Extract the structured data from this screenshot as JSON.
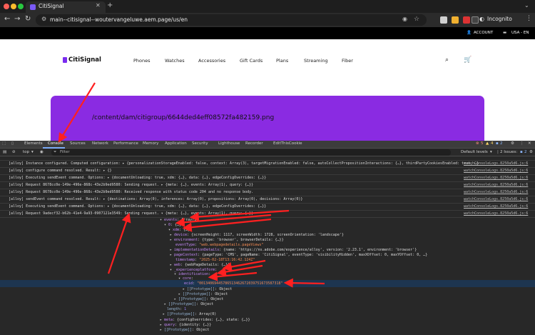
{
  "browser": {
    "tab_title": "CitiSignal",
    "url": "main--citisignal--woutervangeluwe.aem.page/us/en",
    "profile": "Incognito"
  },
  "site": {
    "util": {
      "account": "ACCOUNT",
      "region": "USA - EN"
    },
    "logo": "CitiSignal",
    "nav": [
      "Phones",
      "Watches",
      "Accessories",
      "Gift Cards",
      "Plans",
      "Streaming",
      "Fiber"
    ],
    "hero_text": "/content/dam/citigroup/6644ded4eff08572fa482159.png"
  },
  "devtools": {
    "tabs": [
      "Elements",
      "Console",
      "Sources",
      "Network",
      "Performance",
      "Memory",
      "Application",
      "Security",
      "Lighthouse",
      "Recorder",
      "EditThisCookie"
    ],
    "active_tab": "Console",
    "errors": "5",
    "warnings": "4",
    "info": "2",
    "context": "top",
    "filter_placeholder": "Filter",
    "levels": "Default levels",
    "issues": "2 Issues:",
    "issues_count": "2",
    "logs": [
      "[alloy] Instance configured. Computed configuration:  ▸ {personalizationStorageEnabled: false, context: Array(3), targetMigrationEnabled: false, autoCollectPropositionInteractions: {…}, thirdPartyCookiesEnabled: true, …}",
      "[alloy] configure command resolved. Result:  ▸ {}",
      "[alloy] Executing sendEvent command. Options:  ▸ {documentUnloading: true, xdm: {…}, data: {…}, edgeConfigOverrides: {…}}",
      "[alloy] Request 8678cc0e-149e-496e-868c-43e2b9ed9580: Sending request.  ▸ {meta: {…}, events: Array(1), query: {…}}",
      "[alloy] Request 8678cc0e-149e-496e-868c-43e2b9ed9580: Received response with status code 204 and no response body.",
      "[alloy] sendEvent command resolved. Result:  ▸ {destinations: Array(0), inferences: Array(0), propositions: Array(0), decisions: Array(0)}",
      "[alloy] Executing sendEvent command. Options:  ▸ {documentUnloading: true, xdm: {…}, data: {…}, edgeConfigOverrides: {…}}",
      "[alloy] Request 9adecf32-b62b-41e4-9a93-0907121e3549: Sending request.  ▾ {meta: {…}, events: Array(1), query: {…}}"
    ],
    "log_source": "watchConsoleLogs.8250a5d6.js:6",
    "tree": {
      "events": {
        "key": "events",
        "val": "Array(1)"
      },
      "idx0": {
        "key": "0",
        "val": "{…}"
      },
      "xdm": {
        "key": "xdm",
        "val": "{…}"
      },
      "device": {
        "key": "device",
        "val": "{screenHeight: 1117, screenWidth: 1728, screenOrientation: 'landscape'}"
      },
      "environment": {
        "key": "environment",
        "val": "{type: 'browser', browserDetails: {…}}"
      },
      "eventType": {
        "key": "eventType",
        "val": "\"web.webpagedetails.pageViews\""
      },
      "implementationDetails": {
        "key": "implementationDetails",
        "val": "{name: 'https://ns.adobe.com/experience/alloy', version: '2.23.1', environment: 'browser'}"
      },
      "pageContext": {
        "key": "pageContext",
        "val": "{pageType: 'CMS', pageName: 'CitiSignal', eventType: 'visibilityHidden', maxXOffset: 0, maxYOffset: 0, …}"
      },
      "timestamp": {
        "key": "timestamp",
        "val": "\"2025-02-18T13:16:42.124Z\""
      },
      "web": {
        "key": "web",
        "val": "{webPageDetails: {…}}"
      },
      "experienceplatform": {
        "key": "_experienceplatform",
        "val": ""
      },
      "identification": {
        "key": "identification",
        "val": ""
      },
      "core": {
        "key": "core",
        "val": ""
      },
      "ecid": {
        "key": "ecid",
        "val": "\"00134069445786513462672039751673587318\""
      },
      "proto1": {
        "key": "[[Prototype]]",
        "val": "Object"
      },
      "proto2": {
        "key": "[[Prototype]]",
        "val": "Object"
      },
      "proto3": {
        "key": "[[Prototype]]",
        "val": "Object"
      },
      "proto4": {
        "key": "[[Prototype]]",
        "val": "Object"
      },
      "length": {
        "key": "length",
        "val": "1"
      },
      "proto5": {
        "key": "[[Prototype]]",
        "val": "Array(0)"
      },
      "meta": {
        "key": "meta",
        "val": "{configOverrides: {…}, state: {…}}"
      },
      "query": {
        "key": "query",
        "val": "{identity: {…}}"
      },
      "proto6": {
        "key": "[[Prototype]]",
        "val": "Object"
      }
    }
  },
  "colors": {
    "annotation_arrow": "#ff2020",
    "brand_purple": "#8a2be2",
    "ecid_highlight": "#1d3550"
  }
}
